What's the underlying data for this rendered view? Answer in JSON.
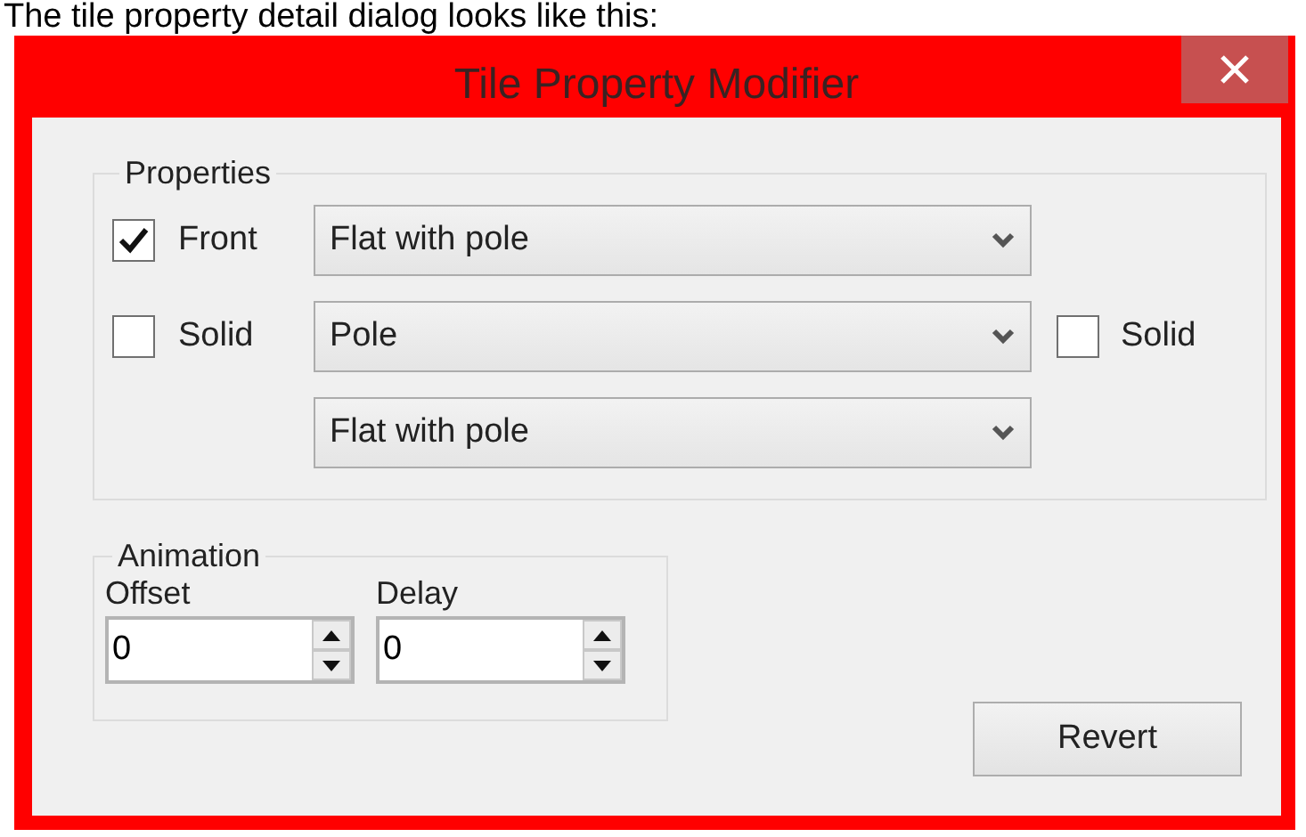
{
  "caption": "The tile property detail dialog looks like this:",
  "window": {
    "title": "Tile Property Modifier"
  },
  "properties": {
    "legend": "Properties",
    "rows": [
      {
        "checkbox": {
          "label": "Front",
          "checked": true
        },
        "combo": {
          "value": "Flat with pole"
        }
      },
      {
        "checkbox": {
          "label": "Solid",
          "checked": false
        },
        "combo": {
          "value": "Pole"
        },
        "right_checkbox": {
          "label": "Solid",
          "checked": false
        }
      },
      {
        "combo": {
          "value": "Flat with pole"
        }
      }
    ]
  },
  "animation": {
    "legend": "Animation",
    "fields": [
      {
        "label": "Offset",
        "value": "0"
      },
      {
        "label": "Delay",
        "value": "0"
      }
    ]
  },
  "buttons": [
    {
      "label": "Revert"
    }
  ]
}
